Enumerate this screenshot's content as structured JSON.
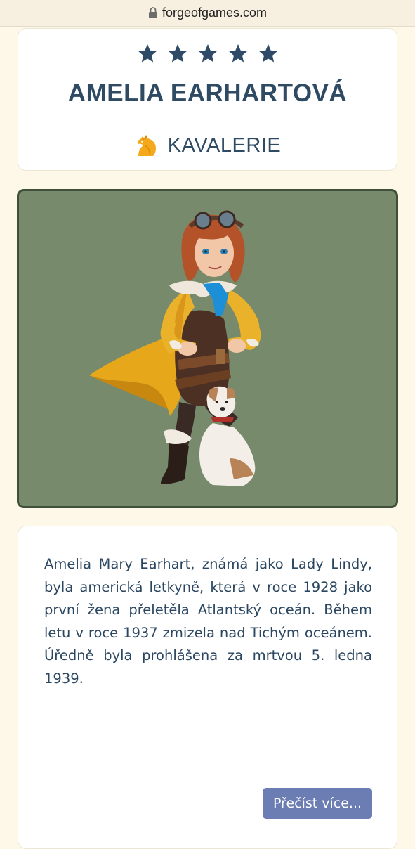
{
  "browser": {
    "domain": "forgeofgames.com"
  },
  "header": {
    "stars": 5,
    "hero_name": "AMELIA EARHARTOVÁ",
    "class_label": "KAVALERIE",
    "class_icon": "horse-head-icon",
    "star_color": "#2e4a66",
    "class_icon_color": "#f4a81c"
  },
  "portrait": {
    "background_color": "#778b6c",
    "frame_color": "#3f4f3a",
    "subject": "hero-portrait"
  },
  "description": {
    "text": "Amelia Mary Earhart, známá jako Lady Lindy, byla americká letkyně, která v roce 1928 jako první žena přeletěla Atlantský oceán. Během letu v roce 1937 zmizela nad Tichým oceánem. Úředně byla prohlášena za mrtvou 5. ledna 1939.",
    "read_more_label": "Přečíst více...",
    "read_more_color": "#6b7db3"
  }
}
